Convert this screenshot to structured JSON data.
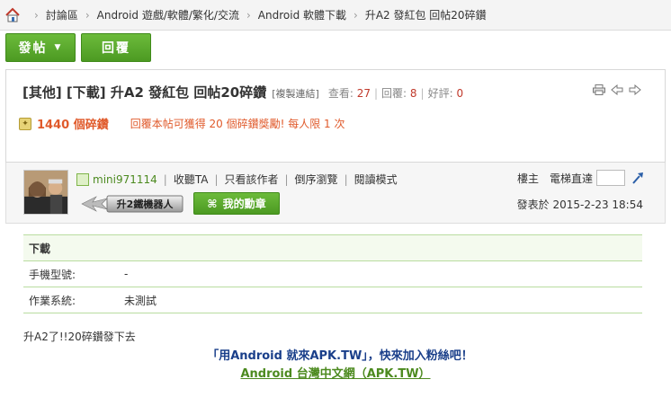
{
  "breadcrumb": {
    "items": [
      "討論區",
      "Android 遊戲/軟體/繁化/交流",
      "Android 軟體下載",
      "升A2 發紅包 回帖20碎鑽"
    ]
  },
  "actions": {
    "post_label": "發帖",
    "reply_label": "回覆"
  },
  "topic": {
    "title": "[其他] [下載] 升A2 發紅包 回帖20碎鑽",
    "copy_link": "[複製連結]",
    "views_label": "查看:",
    "views": "27",
    "replies_label": "回覆:",
    "replies": "8",
    "rating_label": "好評:",
    "rating": "0",
    "coin_count": "1440 個碎鑽",
    "coin_note": "回覆本帖可獲得 20 個碎鑽獎勵! 每人限 1 次"
  },
  "post": {
    "username": "mini971114",
    "actions": [
      "收聽TA",
      "只看該作者",
      "倒序瀏覽",
      "閱讀模式"
    ],
    "rank_badge": "升2鐵機器人",
    "medal_button": "我的勳章",
    "floor": "樓主",
    "jump_label": "電梯直達",
    "posted_at": "發表於 2015-2-23 18:54"
  },
  "info_table": {
    "heading": "下載",
    "rows": [
      {
        "key": "手機型號:",
        "value": "-"
      },
      {
        "key": "作業系統:",
        "value": "未測試"
      }
    ]
  },
  "content": {
    "text": "升A2了!!20碎鑽發下去",
    "promo_line1": "「用Android 就來APK.TW」，快來加入粉絲吧！",
    "promo_line2": "Android 台灣中文網（APK.TW）"
  },
  "colors": {
    "accent_green": "#4c9a22",
    "stat_red": "#c0392b",
    "promo_blue": "#1a3f8a"
  }
}
